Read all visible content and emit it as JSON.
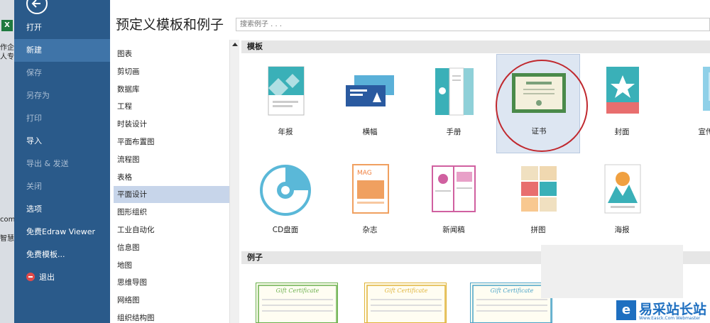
{
  "desktop": {
    "app_icon_letter": "X",
    "snippets": [
      "作企",
      "人专",
      "com",
      "智慧济"
    ]
  },
  "menu": {
    "items": [
      {
        "label": "打开",
        "state": "normal"
      },
      {
        "label": "新建",
        "state": "active"
      },
      {
        "label": "保存",
        "state": "dim"
      },
      {
        "label": "另存为",
        "state": "dim"
      },
      {
        "label": "打印",
        "state": "dim"
      },
      {
        "label": "导入",
        "state": "normal"
      },
      {
        "label": "导出 & 发送",
        "state": "dim"
      },
      {
        "label": "关闭",
        "state": "dim"
      },
      {
        "label": "选项",
        "state": "normal"
      },
      {
        "label": "免费Edraw Viewer",
        "state": "normal"
      },
      {
        "label": "免费模板...",
        "state": "normal"
      },
      {
        "label": "退出",
        "state": "normal"
      }
    ]
  },
  "main": {
    "title": "预定义模板和例子",
    "search_placeholder": "搜索例子 . . ."
  },
  "categories": [
    "图表",
    "剪切画",
    "数据库",
    "工程",
    "时装设计",
    "平面布置图",
    "流程图",
    "表格",
    "平面设计",
    "图形组织",
    "工业自动化",
    "信息图",
    "地图",
    "思维导图",
    "网络图",
    "组织结构图"
  ],
  "selected_category": "平面设计",
  "sections": {
    "templates": "模板",
    "examples": "例子"
  },
  "templates": [
    "年报",
    "横幅",
    "手册",
    "证书",
    "封面",
    "宣传",
    "CD盘面",
    "杂志",
    "新闻稿",
    "拼图",
    "海报"
  ],
  "selected_template": "证书",
  "examples": [
    {
      "title": "Gift Certificate",
      "color": "#6ab04c"
    },
    {
      "title": "Gift Certificate",
      "color": "#e0b43a"
    },
    {
      "title": "Gift Certificate",
      "color": "#4aa3c8"
    }
  ],
  "watermark": {
    "logo_letter": "e",
    "text": "易采站长站",
    "sub": "Www.Easck.Com Webmaster"
  },
  "colors": {
    "menu_bg": "#2a5a8a",
    "menu_active": "#3f74a8",
    "selected_bg": "#c7d5ea",
    "accent_teal": "#3ab0b8"
  }
}
